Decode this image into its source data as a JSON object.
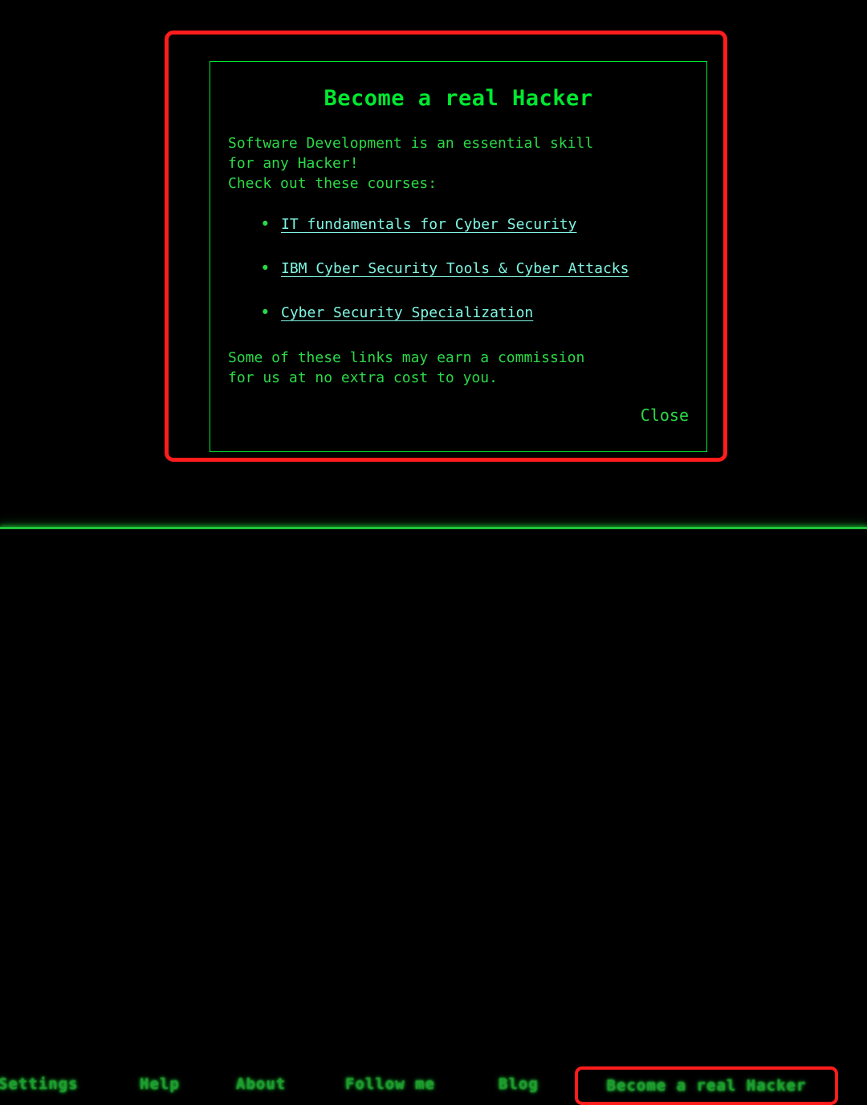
{
  "colors": {
    "background": "#000000",
    "accent_red": "#FF1C1C",
    "terminal_green": "#00E830",
    "body_green": "#2BD947",
    "link_cyan": "#7FF5E2",
    "nav_green": "#1E9E2C"
  },
  "modal": {
    "title": "Become a real Hacker",
    "intro": "Software Development is an essential skill\nfor any Hacker!\nCheck out these courses:",
    "bullet_glyph": "•",
    "courses": [
      {
        "label": "IT fundamentals for Cyber Security"
      },
      {
        "label": "IBM Cyber Security Tools & Cyber Attacks"
      },
      {
        "label": "Cyber Security Specialization"
      }
    ],
    "disclaimer": "Some of these links may earn a commission\nfor us at no extra cost to you.",
    "close_label": "Close"
  },
  "nav": {
    "items": [
      {
        "label": "Settings"
      },
      {
        "label": "Help"
      },
      {
        "label": "About"
      },
      {
        "label": "Follow me"
      },
      {
        "label": "Blog"
      },
      {
        "label": "Become a real Hacker"
      }
    ]
  }
}
